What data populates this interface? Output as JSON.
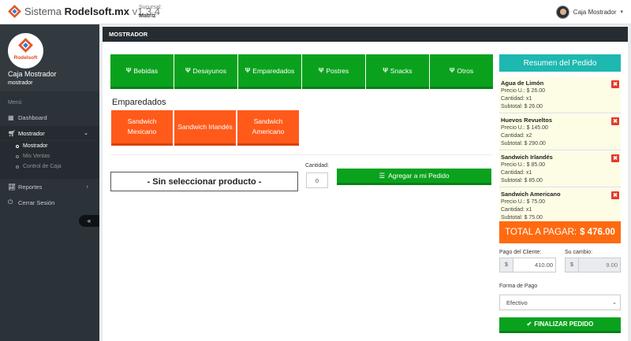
{
  "app": {
    "title_prefix": "Sistema",
    "title_name": "Rodelsoft.mx",
    "version": "v1.3.4",
    "sucursal_label": "Sucursal:",
    "sucursal_value": "Matriz",
    "user_name": "Caja Mostrador",
    "brand_logo_text": "Rodelsoft"
  },
  "sidebar": {
    "profile_name": "Caja Mostrador",
    "profile_role": "mostrador",
    "menu_label": "Menú",
    "items": {
      "dashboard": "Dashboard",
      "mostrador": "Mostrador",
      "reportes": "Reportes",
      "logout": "Cerrar Sesión"
    },
    "submenu": [
      "Mostrador",
      "Mis Ventas",
      "Control de Caja"
    ]
  },
  "main": {
    "panel_title": "MOSTRADOR",
    "categories": [
      "Bebidas",
      "Desayunos",
      "Emparedados",
      "Postres",
      "Snacks",
      "Otros"
    ],
    "section_title": "Emparedados",
    "products": [
      "Sandwich Mexicano",
      "Sandwich Irlandés",
      "Sandwich Americano"
    ],
    "selected_product": "- Sin seleccionar producto -",
    "quantity_label": "Cantidad:",
    "quantity_placeholder": "0",
    "add_button": "Agregar a mi Pedido"
  },
  "summary": {
    "title": "Resumen del Pedido",
    "items": [
      {
        "name": "Agua de Limón",
        "price": "Precio U.: $ 26.00",
        "qty": "Cantidad: x1",
        "subtotal": "Subtotal: $ 26.00"
      },
      {
        "name": "Huevos Revueltos",
        "price": "Precio U.: $ 145.00",
        "qty": "Cantidad: x2",
        "subtotal": "Subtotal: $ 290.00"
      },
      {
        "name": "Sandwich Irlandés",
        "price": "Precio U.: $ 85.00",
        "qty": "Cantidad: x1",
        "subtotal": "Subtotal: $ 85.00"
      },
      {
        "name": "Sandwich Americano",
        "price": "Precio U.: $ 75.00",
        "qty": "Cantidad: x1",
        "subtotal": "Subtotal: $ 75.00"
      }
    ],
    "remove_glyph": "✖",
    "total_label": "TOTAL A PAGAR:",
    "total_value": "$ 476.00",
    "payment_label": "Pago del Cliente:",
    "payment_prefix": "$",
    "payment_value": "410.00",
    "change_label": "Su cambio:",
    "change_prefix": "$",
    "change_value": "9.00",
    "method_label": "Forma de Pago",
    "method_value": "Efectivo",
    "finalize_button": "FINALIZAR PEDIDO"
  },
  "colors": {
    "green": "#0aa21d",
    "orange": "#ff5a1a",
    "teal": "#1db8b0",
    "sidebar": "#2b3238"
  }
}
